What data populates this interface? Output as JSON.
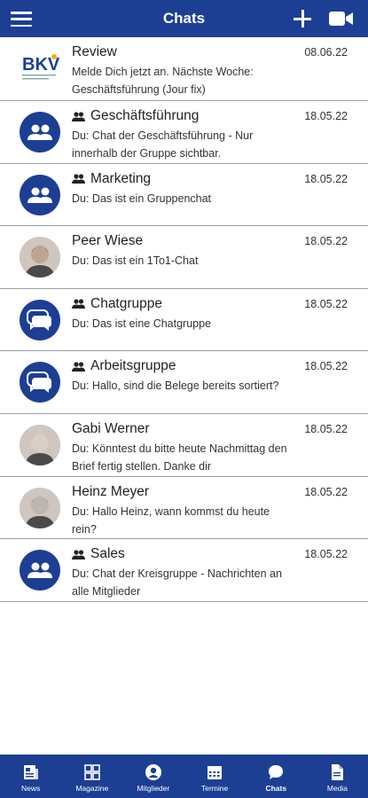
{
  "header": {
    "title": "Chats",
    "menu_icon": "hamburger-icon",
    "add_icon": "plus-icon",
    "video_icon": "video-camera-icon"
  },
  "colors": {
    "brand": "#1c3f94",
    "divider": "#9aa0a8",
    "text": "#222222"
  },
  "chats": [
    {
      "name": "Review",
      "group": false,
      "date": "08.06.22",
      "preview": "Melde Dich jetzt an. Nächste Woche: Geschäftsführung (Jour fix)",
      "avatar": "logo",
      "logo_text": "BKV",
      "logo_subtext": "Bundesverband Kreisverbände"
    },
    {
      "name": "Geschäftsführung",
      "group": true,
      "date": "18.05.22",
      "preview": "Du: Chat der Geschäftsführung - Nur innerhalb der Gruppe sichtbar.",
      "avatar": "group-icon"
    },
    {
      "name": "Marketing",
      "group": true,
      "date": "18.05.22",
      "preview": "Du: Das ist ein Gruppenchat",
      "avatar": "group-icon"
    },
    {
      "name": "Peer Wiese",
      "group": false,
      "date": "18.05.22",
      "preview": "Du: Das ist ein 1To1-Chat",
      "avatar": "photo"
    },
    {
      "name": "Chatgruppe",
      "group": true,
      "date": "18.05.22",
      "preview": "Du: Das ist eine Chatgruppe",
      "avatar": "chat-bubbles-icon"
    },
    {
      "name": "Arbeitsgruppe",
      "group": true,
      "date": "18.05.22",
      "preview": "Du: Hallo, sind die Belege bereits sortiert?",
      "avatar": "chat-bubbles-icon"
    },
    {
      "name": "Gabi Werner",
      "group": false,
      "date": "18.05.22",
      "preview": "Du: Könntest du bitte heute Nachmittag den Brief fertig stellen. Danke dir",
      "avatar": "photo"
    },
    {
      "name": "Heinz Meyer",
      "group": false,
      "date": "18.05.22",
      "preview": "Du: Hallo Heinz, wann kommst du heute rein?",
      "avatar": "photo"
    },
    {
      "name": "Sales",
      "group": true,
      "date": "18.05.22",
      "preview": "Du: Chat der Kreisgruppe - Nachrichten an alle Mitglieder",
      "avatar": "group-icon"
    }
  ],
  "nav": [
    {
      "label": "News",
      "icon": "news-icon",
      "active": false
    },
    {
      "label": "Magazine",
      "icon": "grid-icon",
      "active": false
    },
    {
      "label": "Mitglieder",
      "icon": "person-icon",
      "active": false
    },
    {
      "label": "Termine",
      "icon": "calendar-icon",
      "active": false
    },
    {
      "label": "Chats",
      "icon": "chat-icon",
      "active": true
    },
    {
      "label": "Media",
      "icon": "document-icon",
      "active": false
    }
  ]
}
